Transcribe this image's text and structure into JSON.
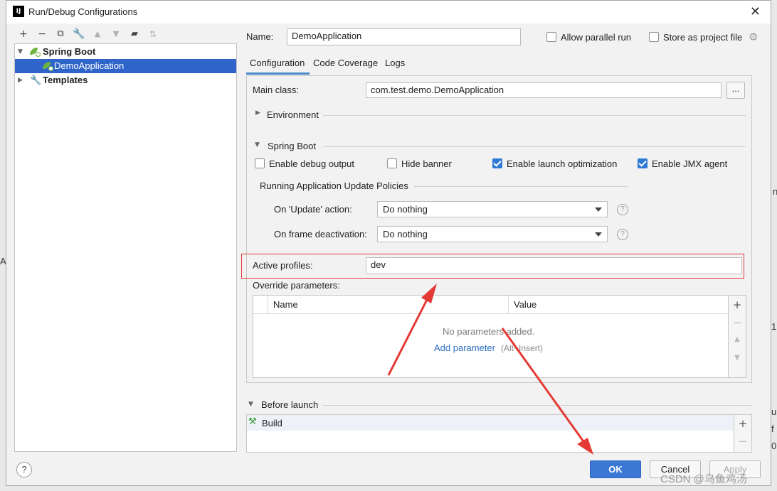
{
  "window": {
    "title": "Run/Debug Configurations",
    "app_icon_text": "IJ"
  },
  "toolbar": {
    "icons": [
      "add-icon",
      "remove-icon",
      "copy-icon",
      "wrench-icon",
      "move-up-icon",
      "move-down-icon",
      "new-folder-icon",
      "sort-icon"
    ]
  },
  "tree": {
    "spring_boot": "Spring Boot",
    "demo_app": "DemoApplication",
    "templates": "Templates"
  },
  "header": {
    "name_label": "Name:",
    "name_value": "DemoApplication",
    "allow_parallel": "Allow parallel run",
    "store_as_file": "Store as project file"
  },
  "tabs": [
    "Configuration",
    "Code Coverage",
    "Logs"
  ],
  "config": {
    "main_class_label": "Main class:",
    "main_class_value": "com.test.demo.DemoApplication",
    "browse": "...",
    "environment": "Environment",
    "spring_boot_section": "Spring Boot",
    "enable_debug": "Enable debug output",
    "hide_banner": "Hide banner",
    "launch_opt": "Enable launch optimization",
    "jmx": "Enable JMX agent",
    "policies_title": "Running Application Update Policies",
    "update_label": "On 'Update' action:",
    "update_value": "Do nothing",
    "frame_label": "On frame deactivation:",
    "frame_value": "Do nothing",
    "active_profiles_label": "Active profiles:",
    "active_profiles_value": "dev",
    "override_label": "Override parameters:",
    "col_name": "Name",
    "col_value": "Value",
    "no_params": "No parameters added.",
    "add_param": "Add parameter",
    "add_param_hint": "(Alt+Insert)"
  },
  "before_launch": {
    "title": "Before launch",
    "build": "Build"
  },
  "buttons": {
    "help": "?",
    "ok": "OK",
    "cancel": "Cancel",
    "apply": "Apply"
  },
  "watermark": "CSDN @乌鱼鸡汤",
  "checkbox_states": {
    "allow_parallel": false,
    "store_as_file": false,
    "enable_debug": false,
    "hide_banner": false,
    "launch_opt": true,
    "jmx": true
  },
  "colors": {
    "selection": "#2f65ca",
    "annotation_red": "#e53935",
    "link": "#2f6fc0"
  }
}
